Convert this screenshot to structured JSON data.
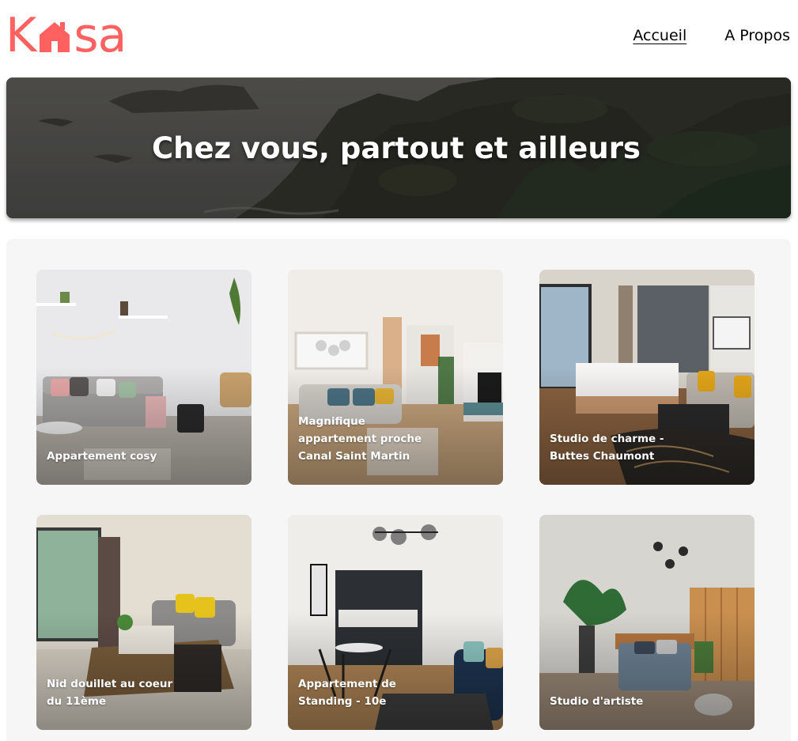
{
  "brand": {
    "logo_left": "K",
    "logo_right": "sa",
    "color": "#FF6060"
  },
  "nav": {
    "items": [
      {
        "label": "Accueil",
        "active": true
      },
      {
        "label": "A Propos",
        "active": false
      }
    ]
  },
  "banner": {
    "title": "Chez vous, partout et ailleurs"
  },
  "gallery": {
    "cards": [
      {
        "title": "Appartement cosy",
        "image_icon": "living-room-photo"
      },
      {
        "title": "Magnifique appartement proche Canal Saint Martin",
        "image_icon": "open-living-room-photo"
      },
      {
        "title": "Studio de charme - Buttes Chaumont",
        "image_icon": "bedroom-studio-photo"
      },
      {
        "title": "Nid douillet au coeur du 11ème",
        "image_icon": "bright-living-room-photo"
      },
      {
        "title": "Appartement de Standing - 10e",
        "image_icon": "kitchen-dining-photo"
      },
      {
        "title": "Studio d'artiste",
        "image_icon": "artist-studio-photo"
      }
    ]
  }
}
